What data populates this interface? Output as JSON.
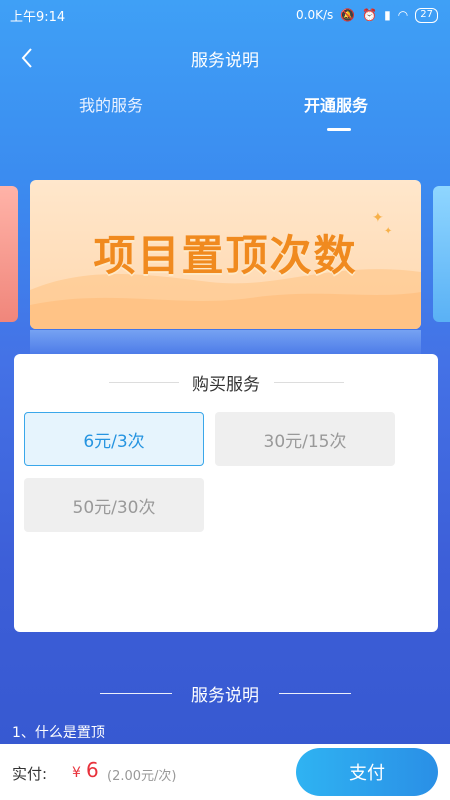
{
  "status_bar": {
    "time": "上午9:14",
    "speed": "0.0K/s",
    "battery": "27"
  },
  "header": {
    "title": "服务说明",
    "back_icon": "chevron-left-icon"
  },
  "tabs": [
    {
      "label": "我的服务",
      "active": false
    },
    {
      "label": "开通服务",
      "active": true
    }
  ],
  "banner": {
    "text": "项目置顶次数"
  },
  "purchase": {
    "heading": "购买服务",
    "options": [
      {
        "label": "6元/3次",
        "selected": true
      },
      {
        "label": "30元/15次",
        "selected": false
      },
      {
        "label": "50元/30次",
        "selected": false
      }
    ]
  },
  "description": {
    "heading": "服务说明",
    "items": [
      "1、什么是置顶"
    ]
  },
  "footer": {
    "paid_label": "实付:",
    "currency": "¥",
    "amount": "6",
    "unit_price": "(2.00元/次)",
    "pay_label": "支付"
  },
  "colors": {
    "accent": "#2a9ae8",
    "price": "#e8313b",
    "banner_text": "#f08a1f"
  }
}
